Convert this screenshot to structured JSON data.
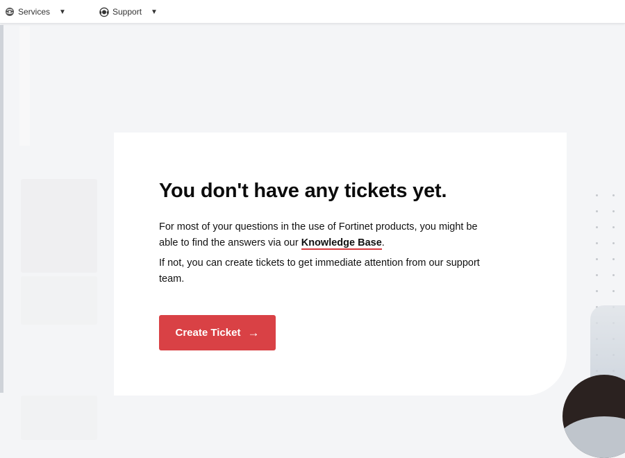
{
  "topnav": {
    "services_label": "Services",
    "support_label": "Support"
  },
  "empty_state": {
    "title": "You don't have any tickets yet.",
    "para1_before": "For most of your questions in the use of Fortinet products, you might be able to find the answers via our ",
    "kb_link": "Knowledge Base",
    "para1_after": ".",
    "para2": "If not, you can create tickets to get immediate attention from our support team.",
    "button_label": "Create Ticket",
    "button_arrow": "→"
  },
  "colors": {
    "accent": "#d94145",
    "background": "#f4f5f7",
    "card": "#ffffff"
  }
}
